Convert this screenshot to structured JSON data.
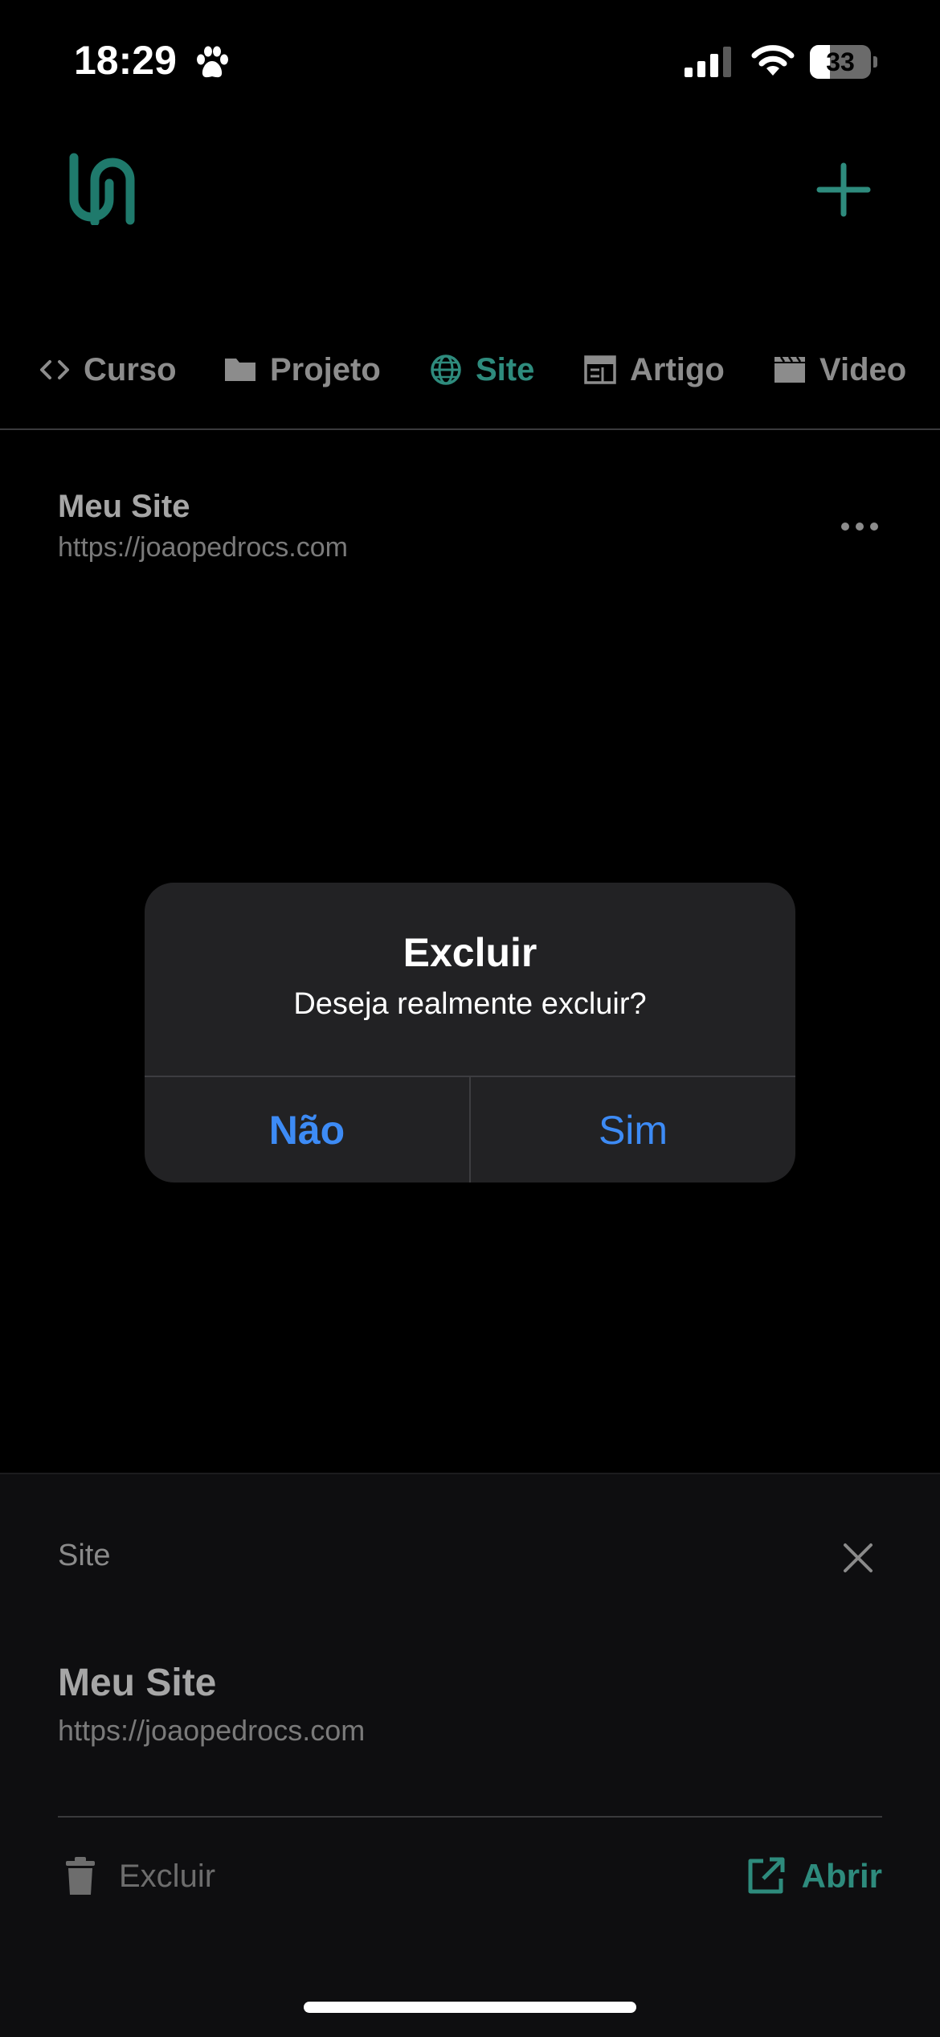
{
  "status_bar": {
    "time": "18:29",
    "battery_level": "33",
    "battery_fraction": 0.33,
    "icons": [
      "paw-icon",
      "signal-icon",
      "wifi-icon",
      "battery-icon"
    ]
  },
  "header": {
    "logo_icon": "app-logo-icon",
    "add_icon": "plus-icon",
    "accent_color": "#2e8b7d"
  },
  "tabs": [
    {
      "label": "Curso",
      "icon": "code-icon",
      "active": false
    },
    {
      "label": "Projeto",
      "icon": "folder-icon",
      "active": false
    },
    {
      "label": "Site",
      "icon": "globe-icon",
      "active": true
    },
    {
      "label": "Artigo",
      "icon": "newspaper-icon",
      "active": false
    },
    {
      "label": "Video",
      "icon": "clapperboard-icon",
      "active": false
    }
  ],
  "list": {
    "items": [
      {
        "title": "Meu Site",
        "url": "https://joaopedrocs.com",
        "menu_icon": "more-horizontal-icon"
      }
    ]
  },
  "sheet": {
    "title": "Site",
    "close_icon": "close-icon",
    "item_title": "Meu Site",
    "item_url": "https://joaopedrocs.com",
    "delete_label": "Excluir",
    "delete_icon": "trash-icon",
    "open_label": "Abrir",
    "open_icon": "external-link-icon"
  },
  "alert": {
    "title": "Excluir",
    "message": "Deseja realmente excluir?",
    "no_label": "Não",
    "yes_label": "Sim",
    "button_color": "#3d8bf5"
  }
}
